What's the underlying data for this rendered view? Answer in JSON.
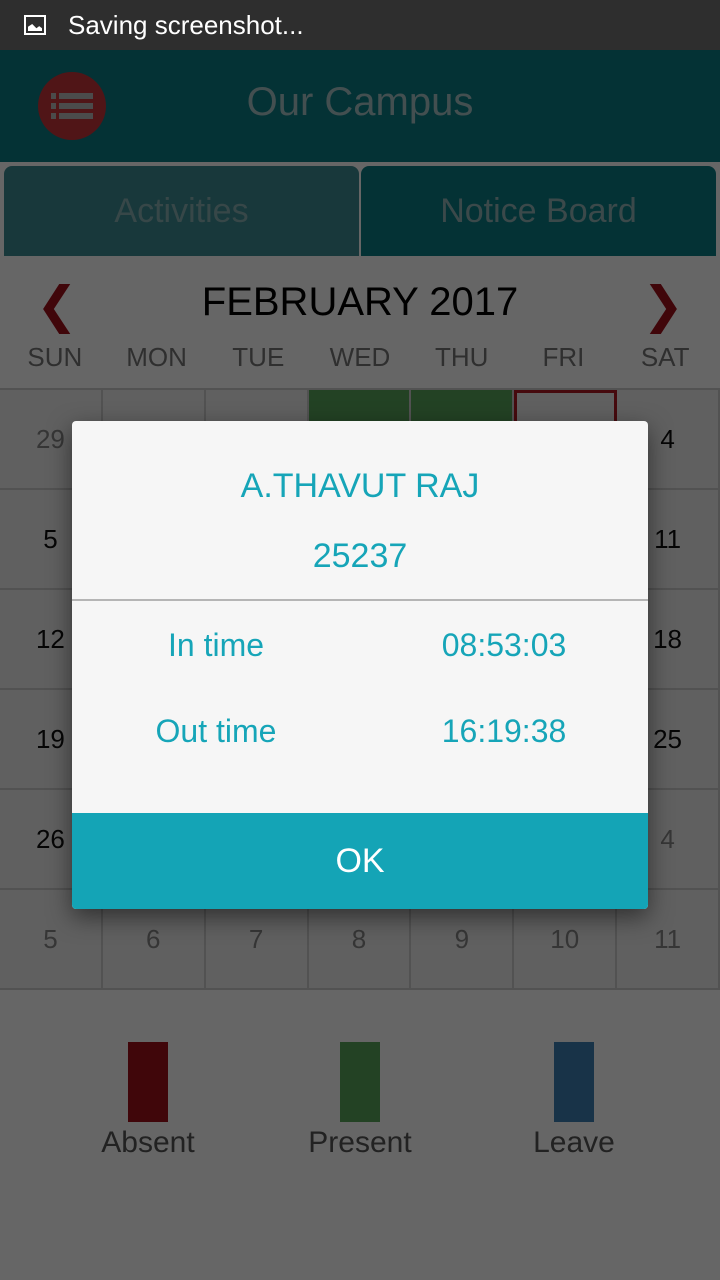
{
  "status_bar": {
    "icon": "image-icon",
    "text": "Saving screenshot..."
  },
  "header": {
    "title": "Our Campus",
    "menu_icon": "list-icon"
  },
  "tabs": [
    {
      "label": "Activities"
    },
    {
      "label": "Notice Board"
    }
  ],
  "calendar": {
    "month_label": "FEBRUARY 2017",
    "prev_icon": "chevron-left-icon",
    "next_icon": "chevron-right-icon",
    "weekdays": [
      "SUN",
      "MON",
      "TUE",
      "WED",
      "THU",
      "FRI",
      "SAT"
    ],
    "weeks": [
      [
        {
          "day": "29",
          "state": "other"
        },
        {
          "day": "",
          "state": "none"
        },
        {
          "day": "",
          "state": "none"
        },
        {
          "day": "",
          "state": "present"
        },
        {
          "day": "",
          "state": "present"
        },
        {
          "day": "",
          "state": "today"
        },
        {
          "day": "4",
          "state": "normal"
        }
      ],
      [
        {
          "day": "5",
          "state": "normal"
        },
        {
          "day": "",
          "state": "none"
        },
        {
          "day": "",
          "state": "none"
        },
        {
          "day": "",
          "state": "none"
        },
        {
          "day": "",
          "state": "none"
        },
        {
          "day": "",
          "state": "none"
        },
        {
          "day": "11",
          "state": "normal"
        }
      ],
      [
        {
          "day": "12",
          "state": "normal"
        },
        {
          "day": "",
          "state": "none"
        },
        {
          "day": "",
          "state": "none"
        },
        {
          "day": "",
          "state": "none"
        },
        {
          "day": "",
          "state": "none"
        },
        {
          "day": "",
          "state": "none"
        },
        {
          "day": "18",
          "state": "normal"
        }
      ],
      [
        {
          "day": "19",
          "state": "normal"
        },
        {
          "day": "",
          "state": "none"
        },
        {
          "day": "",
          "state": "none"
        },
        {
          "day": "",
          "state": "none"
        },
        {
          "day": "",
          "state": "none"
        },
        {
          "day": "",
          "state": "none"
        },
        {
          "day": "25",
          "state": "normal"
        }
      ],
      [
        {
          "day": "26",
          "state": "normal"
        },
        {
          "day": "",
          "state": "none"
        },
        {
          "day": "",
          "state": "none"
        },
        {
          "day": "",
          "state": "none"
        },
        {
          "day": "",
          "state": "none"
        },
        {
          "day": "",
          "state": "none"
        },
        {
          "day": "4",
          "state": "other"
        }
      ],
      [
        {
          "day": "5",
          "state": "other"
        },
        {
          "day": "6",
          "state": "other"
        },
        {
          "day": "7",
          "state": "other"
        },
        {
          "day": "8",
          "state": "other"
        },
        {
          "day": "9",
          "state": "other"
        },
        {
          "day": "10",
          "state": "other"
        },
        {
          "day": "11",
          "state": "other"
        }
      ]
    ]
  },
  "legend": [
    {
      "label": "Absent",
      "color": "#a0111b"
    },
    {
      "label": "Present",
      "color": "#57a65b"
    },
    {
      "label": "Leave",
      "color": "#3c7fb5"
    }
  ],
  "dialog": {
    "name": "A.THAVUT RAJ",
    "id": "25237",
    "rows": [
      {
        "label": "In time",
        "value": "08:53:03"
      },
      {
        "label": "Out time",
        "value": "16:19:38"
      }
    ],
    "ok_label": "OK"
  }
}
